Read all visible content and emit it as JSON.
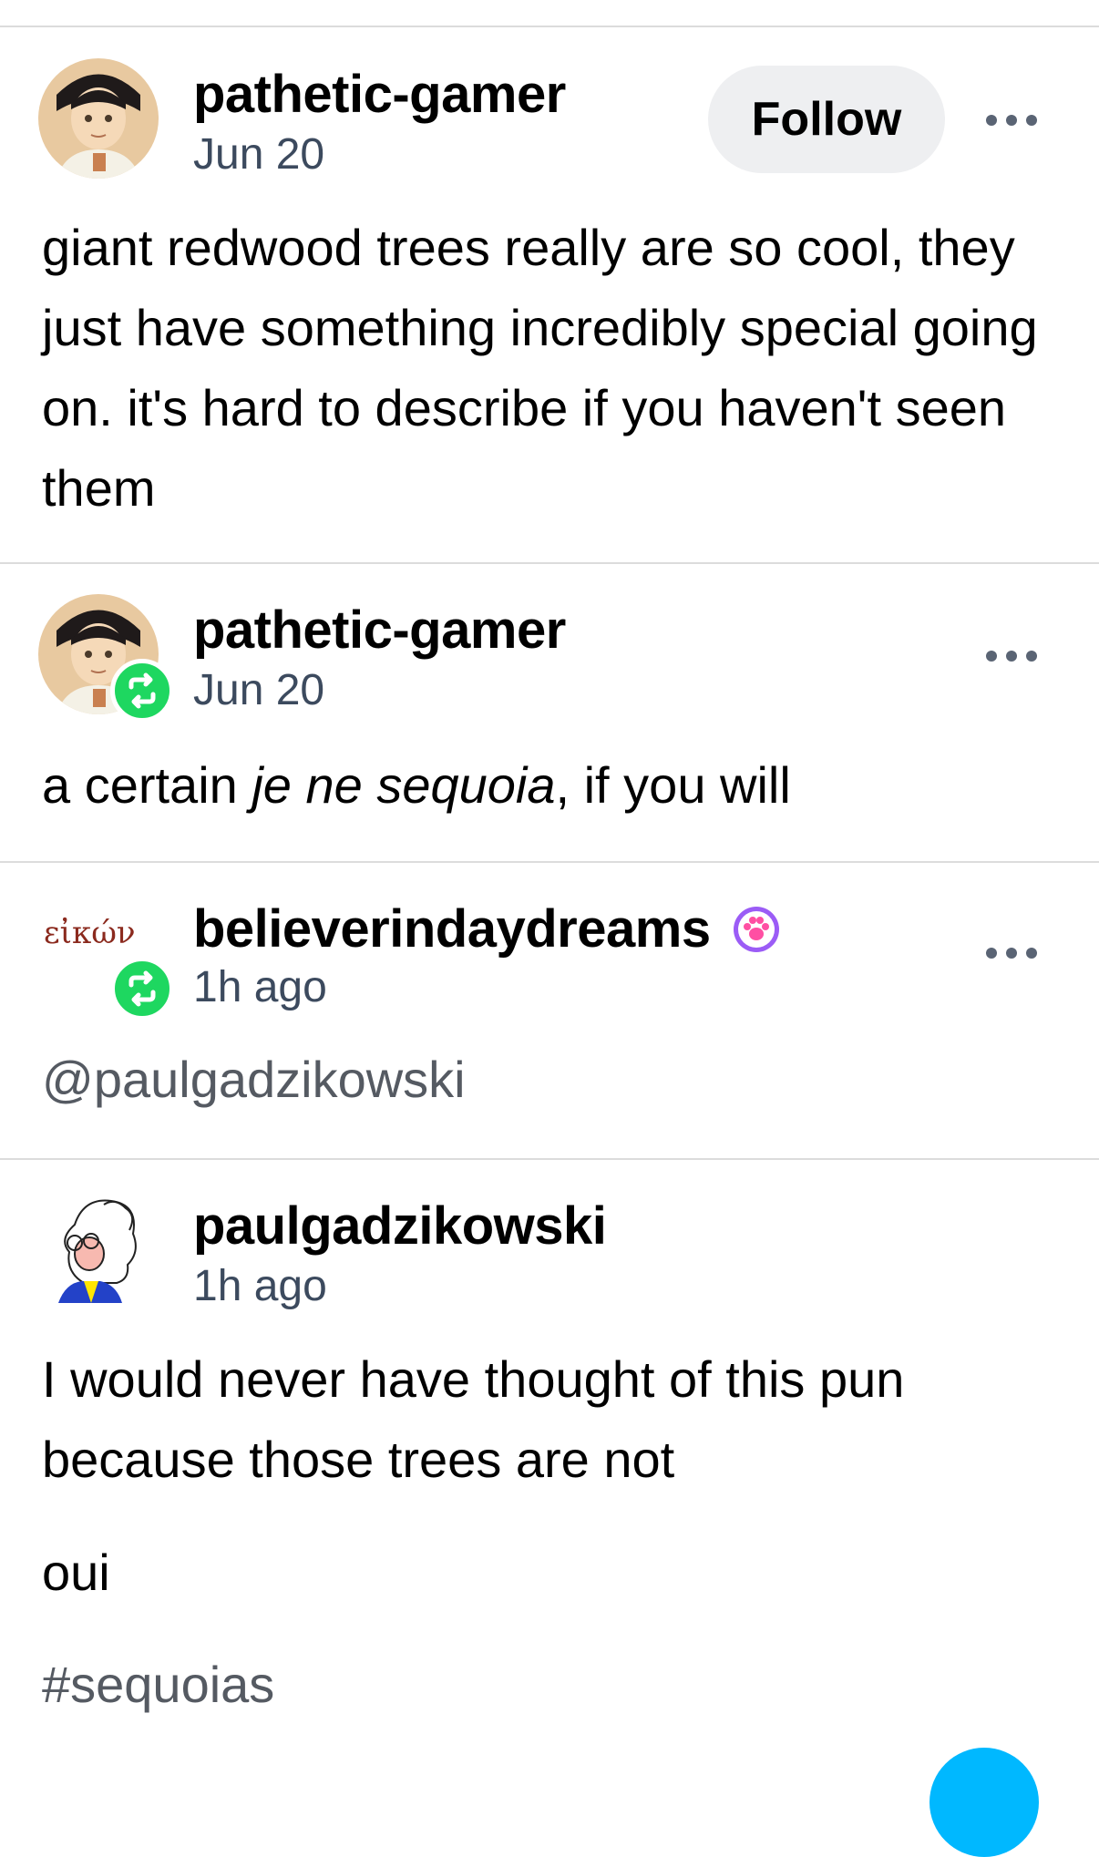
{
  "posts": [
    {
      "username": "pathetic-gamer",
      "date": "Jun 20",
      "follow_label": "Follow",
      "body": "giant redwood trees really are so cool, they just have something incredibly special going on. it's hard to describe if you haven't seen them"
    },
    {
      "username": "pathetic-gamer",
      "date": "Jun 20",
      "body_before": "a certain ",
      "body_italic": "je ne sequoia",
      "body_after": ", if you will"
    },
    {
      "username": "believerindaydreams",
      "date": "1h ago",
      "avatar_text": "εἰκών",
      "mention": "@paulgadzikowski"
    },
    {
      "username": "paulgadzikowski",
      "date": "1h ago",
      "body_line1": "I would never have thought of this pun because those trees are not",
      "body_line2": "oui",
      "tag": "#sequoias"
    }
  ],
  "icons": {
    "more": "more-horizontal-icon",
    "reblog": "reblog-icon",
    "badge": "paw-badge-icon"
  },
  "colors": {
    "reblog_green": "#1ed760",
    "badge_purple": "#9b5cf6",
    "fab_blue": "#00b8ff",
    "timestamp": "#3c4a5e"
  }
}
